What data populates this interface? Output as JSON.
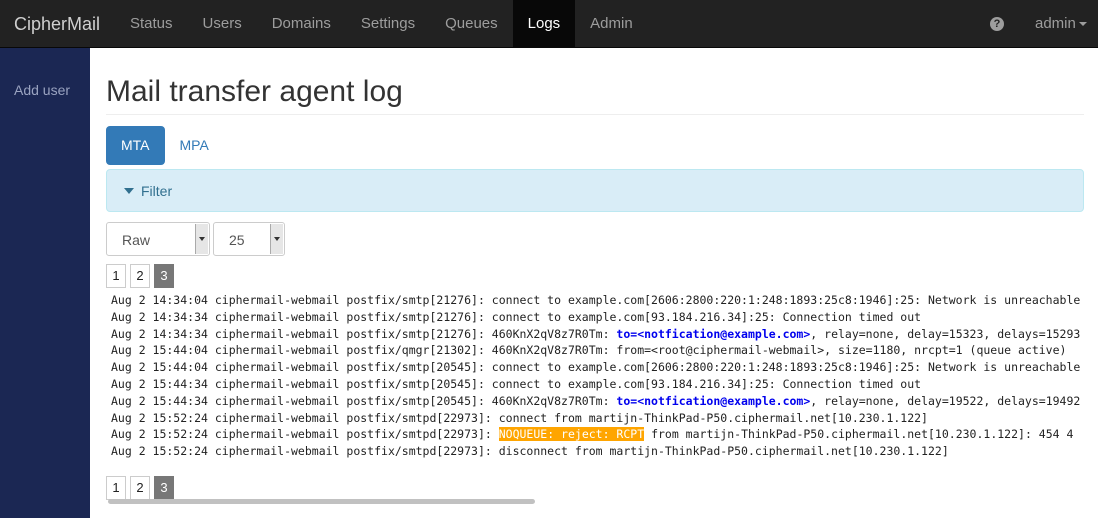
{
  "brand": "CipherMail",
  "nav": [
    {
      "label": "Status"
    },
    {
      "label": "Users"
    },
    {
      "label": "Domains"
    },
    {
      "label": "Settings"
    },
    {
      "label": "Queues"
    },
    {
      "label": "Logs",
      "active": true
    },
    {
      "label": "Admin"
    }
  ],
  "user_menu": {
    "label": "admin",
    "help_icon": "question-circle-icon"
  },
  "sidebar": {
    "items": [
      {
        "label": "Add user"
      }
    ]
  },
  "page": {
    "title": "Mail transfer agent log"
  },
  "tabs": [
    {
      "label": "MTA",
      "active": true
    },
    {
      "label": "MPA"
    }
  ],
  "filter": {
    "label": "Filter"
  },
  "format_select": {
    "value": "Raw"
  },
  "page_size_select": {
    "value": "25"
  },
  "pagination": {
    "pages": [
      "1",
      "2",
      "3"
    ],
    "active": "3"
  },
  "log_lines": [
    {
      "parts": [
        {
          "t": "Aug 2 14:34:04 ciphermail-webmail postfix/smtp[21276]: connect to example.com[2606:2800:220:1:248:1893:25c8:1946]:25: Network is unreachable"
        }
      ]
    },
    {
      "parts": [
        {
          "t": "Aug 2 14:34:34 ciphermail-webmail postfix/smtp[21276]: connect to example.com[93.184.216.34]:25: Connection timed out"
        }
      ]
    },
    {
      "parts": [
        {
          "t": "Aug 2 14:34:34 ciphermail-webmail postfix/smtp[21276]: 460KnX2qV8z7R0Tm: "
        },
        {
          "t": "to=<notfication@example.com>",
          "hl": "to"
        },
        {
          "t": ", relay=none, delay=15323, delays=15293"
        }
      ]
    },
    {
      "parts": [
        {
          "t": "Aug 2 15:44:04 ciphermail-webmail postfix/qmgr[21302]: 460KnX2qV8z7R0Tm: from=<root@ciphermail-webmail>, size=1180, nrcpt=1 (queue active)"
        }
      ]
    },
    {
      "parts": [
        {
          "t": "Aug 2 15:44:04 ciphermail-webmail postfix/smtp[20545]: connect to example.com[2606:2800:220:1:248:1893:25c8:1946]:25: Network is unreachable"
        }
      ]
    },
    {
      "parts": [
        {
          "t": "Aug 2 15:44:34 ciphermail-webmail postfix/smtp[20545]: connect to example.com[93.184.216.34]:25: Connection timed out"
        }
      ]
    },
    {
      "parts": [
        {
          "t": "Aug 2 15:44:34 ciphermail-webmail postfix/smtp[20545]: 460KnX2qV8z7R0Tm: "
        },
        {
          "t": "to=<notfication@example.com>",
          "hl": "to"
        },
        {
          "t": ", relay=none, delay=19522, delays=19492"
        }
      ]
    },
    {
      "parts": [
        {
          "t": "Aug 2 15:52:24 ciphermail-webmail postfix/smtpd[22973]: connect from martijn-ThinkPad-P50.ciphermail.net[10.230.1.122]"
        }
      ]
    },
    {
      "parts": [
        {
          "t": "Aug 2 15:52:24 ciphermail-webmail postfix/smtpd[22973]: "
        },
        {
          "t": "NOQUEUE: reject: RCPT",
          "hl": "noqueue"
        },
        {
          "t": " from martijn-ThinkPad-P50.ciphermail.net[10.230.1.122]: 454 4"
        }
      ]
    },
    {
      "parts": [
        {
          "t": "Aug 2 15:52:24 ciphermail-webmail postfix/smtpd[22973]: disconnect from martijn-ThinkPad-P50.ciphermail.net[10.230.1.122]"
        }
      ]
    }
  ]
}
